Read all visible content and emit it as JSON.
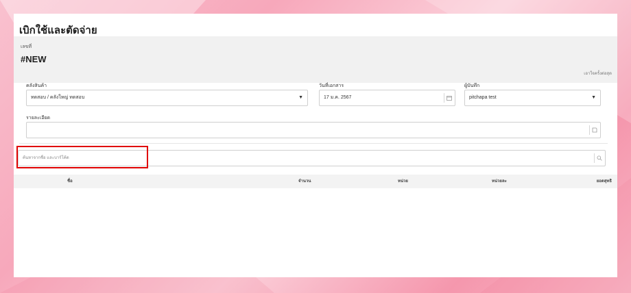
{
  "page": {
    "title": "เบิกใช้และตัดจ่าย"
  },
  "document": {
    "label": "เลขที่",
    "number": "#NEW",
    "note": "เอาใจครั้งต่อสุด"
  },
  "fields": {
    "warehouse": {
      "label": "คลังสินค้า",
      "value": "ทดสอบ / คลังใหญ่ ทดสอบ"
    },
    "doc_date": {
      "label": "วันที่เอกสาร",
      "value": "17 ม.ค. 2567"
    },
    "recorder": {
      "label": "ผู้บันทึก",
      "value": "pitchapa test"
    },
    "details": {
      "label": "รายละเอียด",
      "value": ""
    }
  },
  "search": {
    "placeholder": "ค้นหาจากชื่อ และบาร์โค้ด"
  },
  "table": {
    "columns": [
      "ชื่อ",
      "จำนวน",
      "หน่วย",
      "หน่วยละ",
      "ยอดสุทธิ"
    ],
    "rows": []
  },
  "colors": {
    "highlight": "#e00000",
    "header_bg": "#f1f1f1"
  },
  "icons": {
    "dropdown": "caret-down-icon",
    "calendar": "calendar-icon",
    "note": "note-icon",
    "search": "search-icon"
  }
}
